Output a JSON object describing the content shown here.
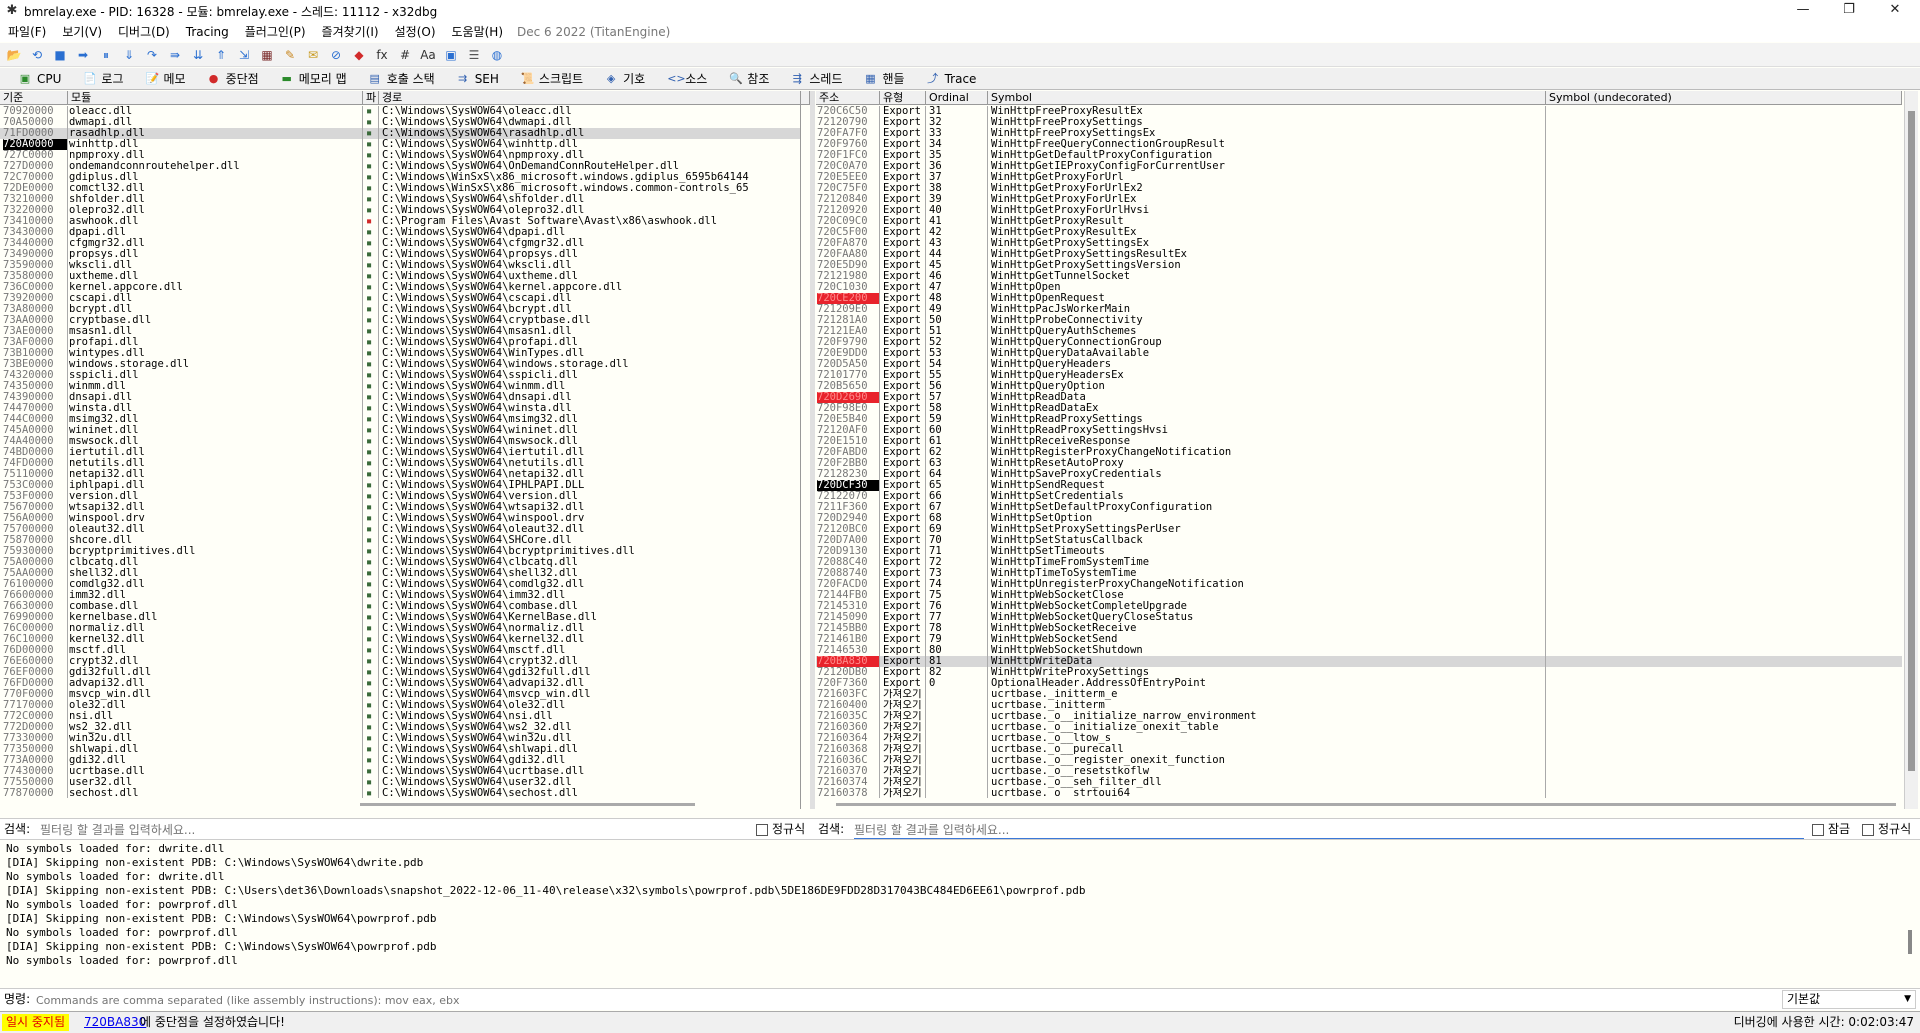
{
  "window": {
    "title": "bmrelay.exe - PID: 16328 - 모듈: bmrelay.exe - 스레드: 11112 - x32dbg",
    "minimize": "—",
    "maximize": "❐",
    "close": "✕"
  },
  "menu": {
    "items": [
      "파일(F)",
      "보기(V)",
      "디버그(D)",
      "Tracing",
      "플러그인(P)",
      "즐겨찾기(I)",
      "설정(O)",
      "도움말(H)"
    ],
    "date": "Dec 6 2022 (TitanEngine)"
  },
  "toolbar": {
    "icons": [
      "open-icon",
      "restart-icon",
      "stop-icon",
      "run-icon",
      "pause-icon",
      "step-into-icon",
      "step-over-icon",
      "trace-into-icon",
      "trace-over-icon",
      "execute-till-return-icon",
      "run-to-user-code-icon",
      "scylla-icon",
      "patch-icon",
      "comment-icon",
      "label-icon",
      "bookmark-icon",
      "function-icon",
      "hash-icon",
      "font-icon",
      "calculator-icon",
      "settings-icon",
      "globe-icon"
    ],
    "glyphs": [
      "📂",
      "⟲",
      "■",
      "➡",
      "⏸",
      "⇓",
      "↷",
      "⇛",
      "⇊",
      "⇑",
      "⇲",
      "▦",
      "✎",
      "✉",
      "⊘",
      "◆",
      "fx",
      "#",
      "Aa",
      "▣",
      "☰",
      "◍"
    ]
  },
  "tabs": [
    {
      "label": "CPU",
      "icon": "cpu-icon",
      "glyph": "▣"
    },
    {
      "label": "로그",
      "icon": "log-icon",
      "glyph": "📄"
    },
    {
      "label": "메모",
      "icon": "notes-icon",
      "glyph": "📝"
    },
    {
      "label": "중단점",
      "icon": "breakpoint-icon",
      "glyph": "●"
    },
    {
      "label": "메모리 맵",
      "icon": "memory-map-icon",
      "glyph": "▬"
    },
    {
      "label": "호출 스택",
      "icon": "call-stack-icon",
      "glyph": "▤"
    },
    {
      "label": "SEH",
      "icon": "seh-icon",
      "glyph": "⇉"
    },
    {
      "label": "스크립트",
      "icon": "script-icon",
      "glyph": "📜"
    },
    {
      "label": "기호",
      "icon": "symbols-icon",
      "glyph": "◈"
    },
    {
      "label": "소스",
      "icon": "source-icon",
      "glyph": "<>"
    },
    {
      "label": "참조",
      "icon": "references-icon",
      "glyph": "🔍"
    },
    {
      "label": "스레드",
      "icon": "threads-icon",
      "glyph": "⇶"
    },
    {
      "label": "핸들",
      "icon": "handles-icon",
      "glyph": "▦"
    },
    {
      "label": "Trace",
      "icon": "trace-icon",
      "glyph": "⤴"
    }
  ],
  "modules": {
    "headers": [
      "기준",
      "모듈",
      "파",
      "경로"
    ],
    "rows": [
      [
        "70920000",
        "oleacc.dll",
        "C:\\Windows\\SysWOW64\\oleacc.dll"
      ],
      [
        "70A50000",
        "dwmapi.dll",
        "C:\\Windows\\SysWOW64\\dwmapi.dll"
      ],
      [
        "71FD0000",
        "rasadhlp.dll",
        "C:\\Windows\\SysWOW64\\rasadhlp.dll"
      ],
      [
        "720A0000",
        "winhttp.dll",
        "C:\\Windows\\SysWOW64\\winhttp.dll"
      ],
      [
        "727C0000",
        "npmproxy.dll",
        "C:\\Windows\\SysWOW64\\npmproxy.dll"
      ],
      [
        "727D0000",
        "ondemandconnroutehelper.dll",
        "C:\\Windows\\SysWOW64\\OnDemandConnRouteHelper.dll"
      ],
      [
        "72C70000",
        "gdiplus.dll",
        "C:\\Windows\\WinSxS\\x86_microsoft.windows.gdiplus_6595b64144"
      ],
      [
        "72DE0000",
        "comctl32.dll",
        "C:\\Windows\\WinSxS\\x86_microsoft.windows.common-controls_65"
      ],
      [
        "73210000",
        "shfolder.dll",
        "C:\\Windows\\SysWOW64\\shfolder.dll"
      ],
      [
        "73220000",
        "olepro32.dll",
        "C:\\Windows\\SysWOW64\\olepro32.dll"
      ],
      [
        "73410000",
        "aswhook.dll",
        "C:\\Program Files\\Avast Software\\Avast\\x86\\aswhook.dll"
      ],
      [
        "73430000",
        "dpapi.dll",
        "C:\\Windows\\SysWOW64\\dpapi.dll"
      ],
      [
        "73440000",
        "cfgmgr32.dll",
        "C:\\Windows\\SysWOW64\\cfgmgr32.dll"
      ],
      [
        "73490000",
        "propsys.dll",
        "C:\\Windows\\SysWOW64\\propsys.dll"
      ],
      [
        "73590000",
        "wkscli.dll",
        "C:\\Windows\\SysWOW64\\wkscli.dll"
      ],
      [
        "73580000",
        "uxtheme.dll",
        "C:\\Windows\\SysWOW64\\uxtheme.dll"
      ],
      [
        "736C0000",
        "kernel.appcore.dll",
        "C:\\Windows\\SysWOW64\\kernel.appcore.dll"
      ],
      [
        "73920000",
        "cscapi.dll",
        "C:\\Windows\\SysWOW64\\cscapi.dll"
      ],
      [
        "73A80000",
        "bcrypt.dll",
        "C:\\Windows\\SysWOW64\\bcrypt.dll"
      ],
      [
        "73AA0000",
        "cryptbase.dll",
        "C:\\Windows\\SysWOW64\\cryptbase.dll"
      ],
      [
        "73AE0000",
        "msasn1.dll",
        "C:\\Windows\\SysWOW64\\msasn1.dll"
      ],
      [
        "73AF0000",
        "profapi.dll",
        "C:\\Windows\\SysWOW64\\profapi.dll"
      ],
      [
        "73B10000",
        "wintypes.dll",
        "C:\\Windows\\SysWOW64\\WinTypes.dll"
      ],
      [
        "73BE0000",
        "windows.storage.dll",
        "C:\\Windows\\SysWOW64\\windows.storage.dll"
      ],
      [
        "74320000",
        "sspicli.dll",
        "C:\\Windows\\SysWOW64\\sspicli.dll"
      ],
      [
        "74350000",
        "winmm.dll",
        "C:\\Windows\\SysWOW64\\winmm.dll"
      ],
      [
        "74390000",
        "dnsapi.dll",
        "C:\\Windows\\SysWOW64\\dnsapi.dll"
      ],
      [
        "74470000",
        "winsta.dll",
        "C:\\Windows\\SysWOW64\\winsta.dll"
      ],
      [
        "744C0000",
        "msimg32.dll",
        "C:\\Windows\\SysWOW64\\msimg32.dll"
      ],
      [
        "745A0000",
        "wininet.dll",
        "C:\\Windows\\SysWOW64\\wininet.dll"
      ],
      [
        "74A40000",
        "mswsock.dll",
        "C:\\Windows\\SysWOW64\\mswsock.dll"
      ],
      [
        "74BD0000",
        "iertutil.dll",
        "C:\\Windows\\SysWOW64\\iertutil.dll"
      ],
      [
        "74FD0000",
        "netutils.dll",
        "C:\\Windows\\SysWOW64\\netutils.dll"
      ],
      [
        "75110000",
        "netapi32.dll",
        "C:\\Windows\\SysWOW64\\netapi32.dll"
      ],
      [
        "753C0000",
        "iphlpapi.dll",
        "C:\\Windows\\SysWOW64\\IPHLPAPI.DLL"
      ],
      [
        "753F0000",
        "version.dll",
        "C:\\Windows\\SysWOW64\\version.dll"
      ],
      [
        "75670000",
        "wtsapi32.dll",
        "C:\\Windows\\SysWOW64\\wtsapi32.dll"
      ],
      [
        "756A0000",
        "winspool.drv",
        "C:\\Windows\\SysWOW64\\winspool.drv"
      ],
      [
        "75700000",
        "oleaut32.dll",
        "C:\\Windows\\SysWOW64\\oleaut32.dll"
      ],
      [
        "75870000",
        "shcore.dll",
        "C:\\Windows\\SysWOW64\\SHCore.dll"
      ],
      [
        "75930000",
        "bcryptprimitives.dll",
        "C:\\Windows\\SysWOW64\\bcryptprimitives.dll"
      ],
      [
        "75A00000",
        "clbcatq.dll",
        "C:\\Windows\\SysWOW64\\clbcatq.dll"
      ],
      [
        "75AA0000",
        "shell32.dll",
        "C:\\Windows\\SysWOW64\\shell32.dll"
      ],
      [
        "76100000",
        "comdlg32.dll",
        "C:\\Windows\\SysWOW64\\comdlg32.dll"
      ],
      [
        "76600000",
        "imm32.dll",
        "C:\\Windows\\SysWOW64\\imm32.dll"
      ],
      [
        "76630000",
        "combase.dll",
        "C:\\Windows\\SysWOW64\\combase.dll"
      ],
      [
        "76990000",
        "kernelbase.dll",
        "C:\\Windows\\SysWOW64\\KernelBase.dll"
      ],
      [
        "76C00000",
        "normaliz.dll",
        "C:\\Windows\\SysWOW64\\normaliz.dll"
      ],
      [
        "76C10000",
        "kernel32.dll",
        "C:\\Windows\\SysWOW64\\kernel32.dll"
      ],
      [
        "76D00000",
        "msctf.dll",
        "C:\\Windows\\SysWOW64\\msctf.dll"
      ],
      [
        "76E60000",
        "crypt32.dll",
        "C:\\Windows\\SysWOW64\\crypt32.dll"
      ],
      [
        "76EF0000",
        "gdi32full.dll",
        "C:\\Windows\\SysWOW64\\gdi32full.dll"
      ],
      [
        "76FD0000",
        "advapi32.dll",
        "C:\\Windows\\SysWOW64\\advapi32.dll"
      ],
      [
        "770F0000",
        "msvcp_win.dll",
        "C:\\Windows\\SysWOW64\\msvcp_win.dll"
      ],
      [
        "77170000",
        "ole32.dll",
        "C:\\Windows\\SysWOW64\\ole32.dll"
      ],
      [
        "772C0000",
        "nsi.dll",
        "C:\\Windows\\SysWOW64\\nsi.dll"
      ],
      [
        "772D0000",
        "ws2_32.dll",
        "C:\\Windows\\SysWOW64\\ws2_32.dll"
      ],
      [
        "77330000",
        "win32u.dll",
        "C:\\Windows\\SysWOW64\\win32u.dll"
      ],
      [
        "77350000",
        "shlwapi.dll",
        "C:\\Windows\\SysWOW64\\shlwapi.dll"
      ],
      [
        "773A0000",
        "gdi32.dll",
        "C:\\Windows\\SysWOW64\\gdi32.dll"
      ],
      [
        "77430000",
        "ucrtbase.dll",
        "C:\\Windows\\SysWOW64\\ucrtbase.dll"
      ],
      [
        "77550000",
        "user32.dll",
        "C:\\Windows\\SysWOW64\\user32.dll"
      ],
      [
        "77870000",
        "sechost.dll",
        "C:\\Windows\\SysWOW64\\sechost.dll"
      ]
    ]
  },
  "symbols": {
    "headers": [
      "주소",
      "유형",
      "Ordinal",
      "Symbol",
      "Symbol (undecorated)"
    ],
    "rows": [
      [
        "720C6C50",
        "Export",
        "31",
        "WinHttpFreeProxyResultEx"
      ],
      [
        "72120790",
        "Export",
        "32",
        "WinHttpFreeProxySettings"
      ],
      [
        "720FA7F0",
        "Export",
        "33",
        "WinHttpFreeProxySettingsEx"
      ],
      [
        "720F9760",
        "Export",
        "34",
        "WinHttpFreeQueryConnectionGroupResult"
      ],
      [
        "720F1FC0",
        "Export",
        "35",
        "WinHttpGetDefaultProxyConfiguration"
      ],
      [
        "720C0A70",
        "Export",
        "36",
        "WinHttpGetIEProxyConfigForCurrentUser"
      ],
      [
        "720E5EE0",
        "Export",
        "37",
        "WinHttpGetProxyForUrl"
      ],
      [
        "720C75F0",
        "Export",
        "38",
        "WinHttpGetProxyForUrlEx2"
      ],
      [
        "72120840",
        "Export",
        "39",
        "WinHttpGetProxyForUrlEx"
      ],
      [
        "72120920",
        "Export",
        "40",
        "WinHttpGetProxyForUrlHvsi"
      ],
      [
        "720C09C0",
        "Export",
        "41",
        "WinHttpGetProxyResult"
      ],
      [
        "720C5F00",
        "Export",
        "42",
        "WinHttpGetProxyResultEx"
      ],
      [
        "720FA870",
        "Export",
        "43",
        "WinHttpGetProxySettingsEx"
      ],
      [
        "720FAA80",
        "Export",
        "44",
        "WinHttpGetProxySettingsResultEx"
      ],
      [
        "720E5D90",
        "Export",
        "45",
        "WinHttpGetProxySettingsVersion"
      ],
      [
        "72121980",
        "Export",
        "46",
        "WinHttpGetTunnelSocket"
      ],
      [
        "720C1030",
        "Export",
        "47",
        "WinHttpOpen"
      ],
      [
        "720CE200",
        "Export",
        "48",
        "WinHttpOpenRequest"
      ],
      [
        "721209E0",
        "Export",
        "49",
        "WinHttpPacJsWorkerMain"
      ],
      [
        "721281A0",
        "Export",
        "50",
        "WinHttpProbeConnectivity"
      ],
      [
        "72121EA0",
        "Export",
        "51",
        "WinHttpQueryAuthSchemes"
      ],
      [
        "720F9790",
        "Export",
        "52",
        "WinHttpQueryConnectionGroup"
      ],
      [
        "720E9DD0",
        "Export",
        "53",
        "WinHttpQueryDataAvailable"
      ],
      [
        "720D5A50",
        "Export",
        "54",
        "WinHttpQueryHeaders"
      ],
      [
        "72101770",
        "Export",
        "55",
        "WinHttpQueryHeadersEx"
      ],
      [
        "720B5650",
        "Export",
        "56",
        "WinHttpQueryOption"
      ],
      [
        "720D2690",
        "Export",
        "57",
        "WinHttpReadData"
      ],
      [
        "720F98E0",
        "Export",
        "58",
        "WinHttpReadDataEx"
      ],
      [
        "720E5B40",
        "Export",
        "59",
        "WinHttpReadProxySettings"
      ],
      [
        "72120AF0",
        "Export",
        "60",
        "WinHttpReadProxySettingsHvsi"
      ],
      [
        "720E1510",
        "Export",
        "61",
        "WinHttpReceiveResponse"
      ],
      [
        "720FABD0",
        "Export",
        "62",
        "WinHttpRegisterProxyChangeNotification"
      ],
      [
        "720F2BB0",
        "Export",
        "63",
        "WinHttpResetAutoProxy"
      ],
      [
        "72128230",
        "Export",
        "64",
        "WinHttpSaveProxyCredentials"
      ],
      [
        "720DCF30",
        "Export",
        "65",
        "WinHttpSendRequest"
      ],
      [
        "72122070",
        "Export",
        "66",
        "WinHttpSetCredentials"
      ],
      [
        "7211F360",
        "Export",
        "67",
        "WinHttpSetDefaultProxyConfiguration"
      ],
      [
        "720D2940",
        "Export",
        "68",
        "WinHttpSetOption"
      ],
      [
        "72120BC0",
        "Export",
        "69",
        "WinHttpSetProxySettingsPerUser"
      ],
      [
        "720D7A00",
        "Export",
        "70",
        "WinHttpSetStatusCallback"
      ],
      [
        "720D9130",
        "Export",
        "71",
        "WinHttpSetTimeouts"
      ],
      [
        "72088C40",
        "Export",
        "72",
        "WinHttpTimeFromSystemTime"
      ],
      [
        "72088740",
        "Export",
        "73",
        "WinHttpTimeToSystemTime"
      ],
      [
        "720FACD0",
        "Export",
        "74",
        "WinHttpUnregisterProxyChangeNotification"
      ],
      [
        "72144FB0",
        "Export",
        "75",
        "WinHttpWebSocketClose"
      ],
      [
        "72145310",
        "Export",
        "76",
        "WinHttpWebSocketCompleteUpgrade"
      ],
      [
        "72145090",
        "Export",
        "77",
        "WinHttpWebSocketQueryCloseStatus"
      ],
      [
        "72145BB0",
        "Export",
        "78",
        "WinHttpWebSocketReceive"
      ],
      [
        "721461B0",
        "Export",
        "79",
        "WinHttpWebSocketSend"
      ],
      [
        "72146530",
        "Export",
        "80",
        "WinHttpWebSocketShutdown"
      ],
      [
        "720BA830",
        "Export",
        "81",
        "WinHttpWriteData"
      ],
      [
        "72120DB0",
        "Export",
        "82",
        "WinHttpWriteProxySettings"
      ],
      [
        "720F7360",
        "Export",
        "0",
        "OptionalHeader.AddressOfEntryPoint"
      ],
      [
        "721603FC",
        "가져오기",
        "",
        "ucrtbase._initterm_e"
      ],
      [
        "72160400",
        "가져오기",
        "",
        "ucrtbase._initterm"
      ],
      [
        "7216035C",
        "가져오기",
        "",
        "ucrtbase._o__initialize_narrow_environment"
      ],
      [
        "72160360",
        "가져오기",
        "",
        "ucrtbase._o__initialize_onexit_table"
      ],
      [
        "72160364",
        "가져오기",
        "",
        "ucrtbase._o__ltow_s"
      ],
      [
        "72160368",
        "가져오기",
        "",
        "ucrtbase._o__purecall"
      ],
      [
        "7216036C",
        "가져오기",
        "",
        "ucrtbase._o__register_onexit_function"
      ],
      [
        "72160370",
        "가져오기",
        "",
        "ucrtbase._o__resetstkoflw"
      ],
      [
        "72160374",
        "가져오기",
        "",
        "ucrtbase._o__seh_filter_dll"
      ],
      [
        "72160378",
        "가져오기",
        "",
        "ucrtbase._o__strtoui64"
      ]
    ]
  },
  "search": {
    "label_left": "검색:",
    "placeholder_left": "필터링 할 결과를 입력하세요...",
    "regex_left": "정규식",
    "label_right": "검색:",
    "placeholder_right": "필터링 할 결과를 입력하세요...",
    "lock": "잠금",
    "regex_right": "정규식"
  },
  "log": {
    "lines": [
      "No symbols loaded for: dwrite.dll",
      "[DIA] Skipping non-existent PDB: C:\\Windows\\SysWOW64\\dwrite.pdb",
      "No symbols loaded for: dwrite.dll",
      "[DIA] Skipping non-existent PDB: C:\\Users\\det36\\Downloads\\snapshot_2022-12-06_11-40\\release\\x32\\symbols\\powrprof.pdb\\5DE186DE9FDD28D317043BC484ED6EE61\\powrprof.pdb",
      "No symbols loaded for: powrprof.dll",
      "[DIA] Skipping non-existent PDB: C:\\Windows\\SysWOW64\\powrprof.pdb",
      "No symbols loaded for: powrprof.dll",
      "[DIA] Skipping non-existent PDB: C:\\Windows\\SysWOW64\\powrprof.pdb",
      "No symbols loaded for: powrprof.dll"
    ]
  },
  "command": {
    "label": "명령:",
    "placeholder": "Commands are comma separated (like assembly instructions): mov eax, ebx",
    "default": "기본값"
  },
  "status": {
    "state": "일시 중지됨",
    "bp_addr": "720BA830",
    "bp_msg": "에 중단점을 설정하였습니다!",
    "time": "디버깅에 사용한 시간: 0:02:03:47"
  }
}
